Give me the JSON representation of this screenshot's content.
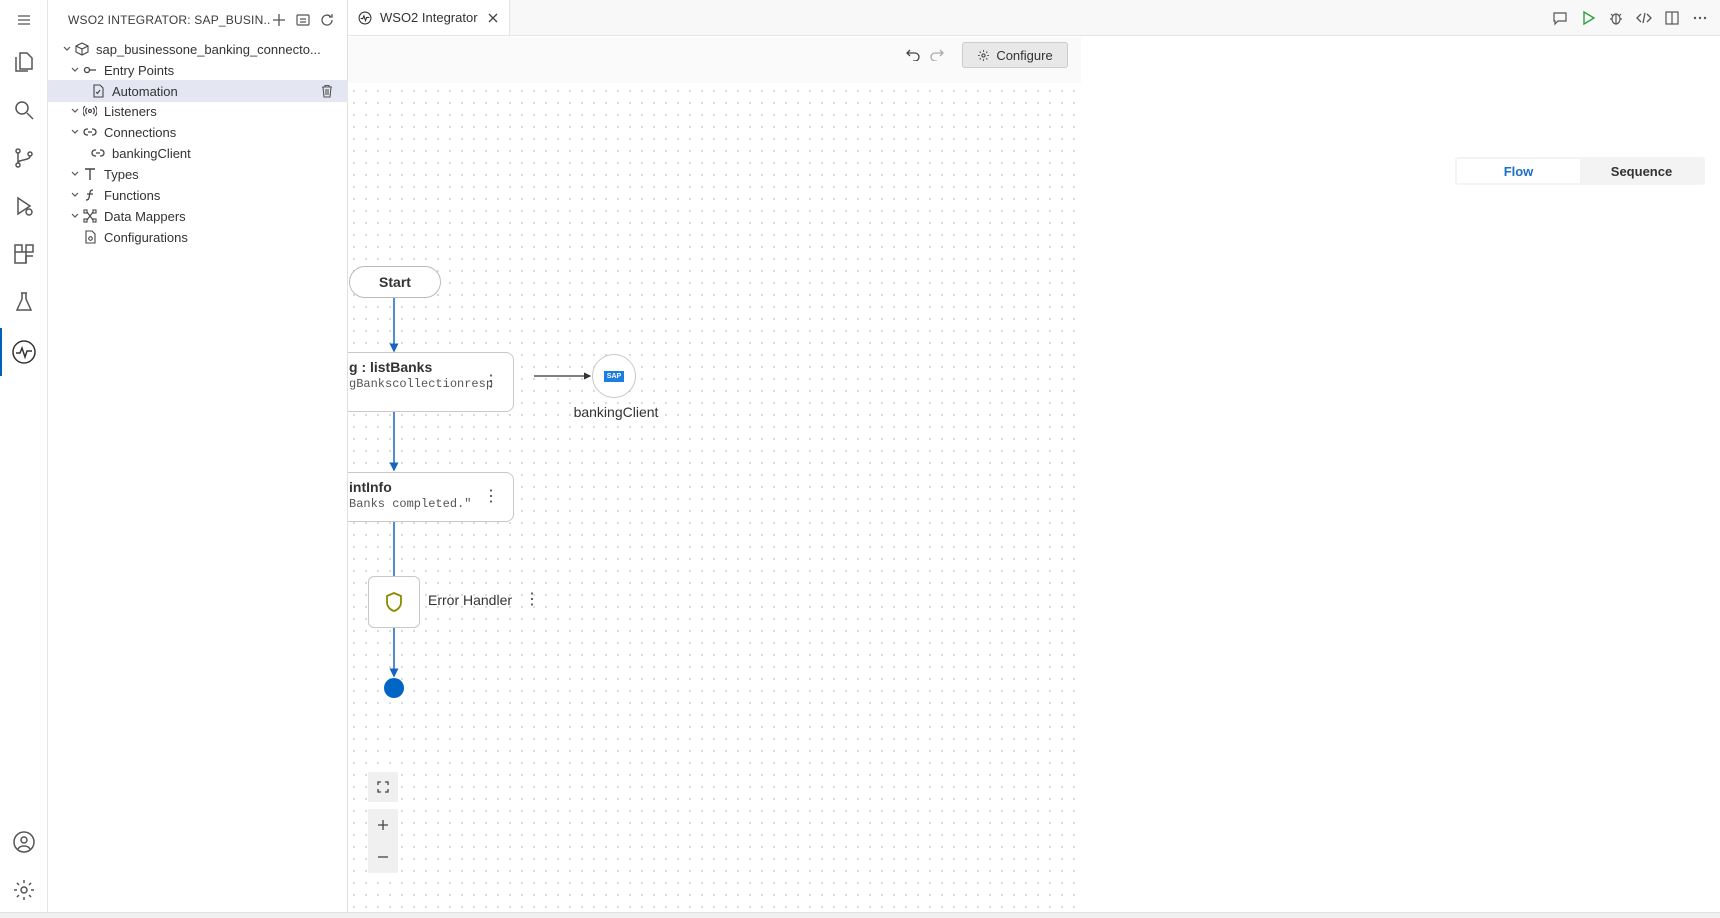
{
  "sidebar": {
    "title": "WSO2 INTEGRATOR: SAP_BUSIN...",
    "project": "sap_businessone_banking_connecto...",
    "tree": {
      "entry_points": "Entry Points",
      "automation": "Automation",
      "listeners": "Listeners",
      "connections": "Connections",
      "banking_client": "bankingClient",
      "types": "Types",
      "functions": "Functions",
      "data_mappers": "Data Mappers",
      "configurations": "Configurations"
    }
  },
  "editor": {
    "tab_label": "WSO2 Integrator",
    "configure_label": "Configure"
  },
  "flow": {
    "start_label": "Start",
    "node1_title": "g : listBanks",
    "node1_sub": "gBankscollectionresp",
    "node2_title": "intInfo",
    "node2_sub": "Banks completed.\"",
    "connection_label": "bankingClient",
    "connection_logo": "SAP",
    "error_handler_label": "Error Handler"
  },
  "view_toggle": {
    "flow": "Flow",
    "sequence": "Sequence",
    "active": "Flow"
  },
  "colors": {
    "accent": "#005fb8",
    "flow_line": "#1565c0",
    "end_dot": "#0066c5",
    "selected_row": "#e4e6f1",
    "shield": "#8a8a00"
  }
}
